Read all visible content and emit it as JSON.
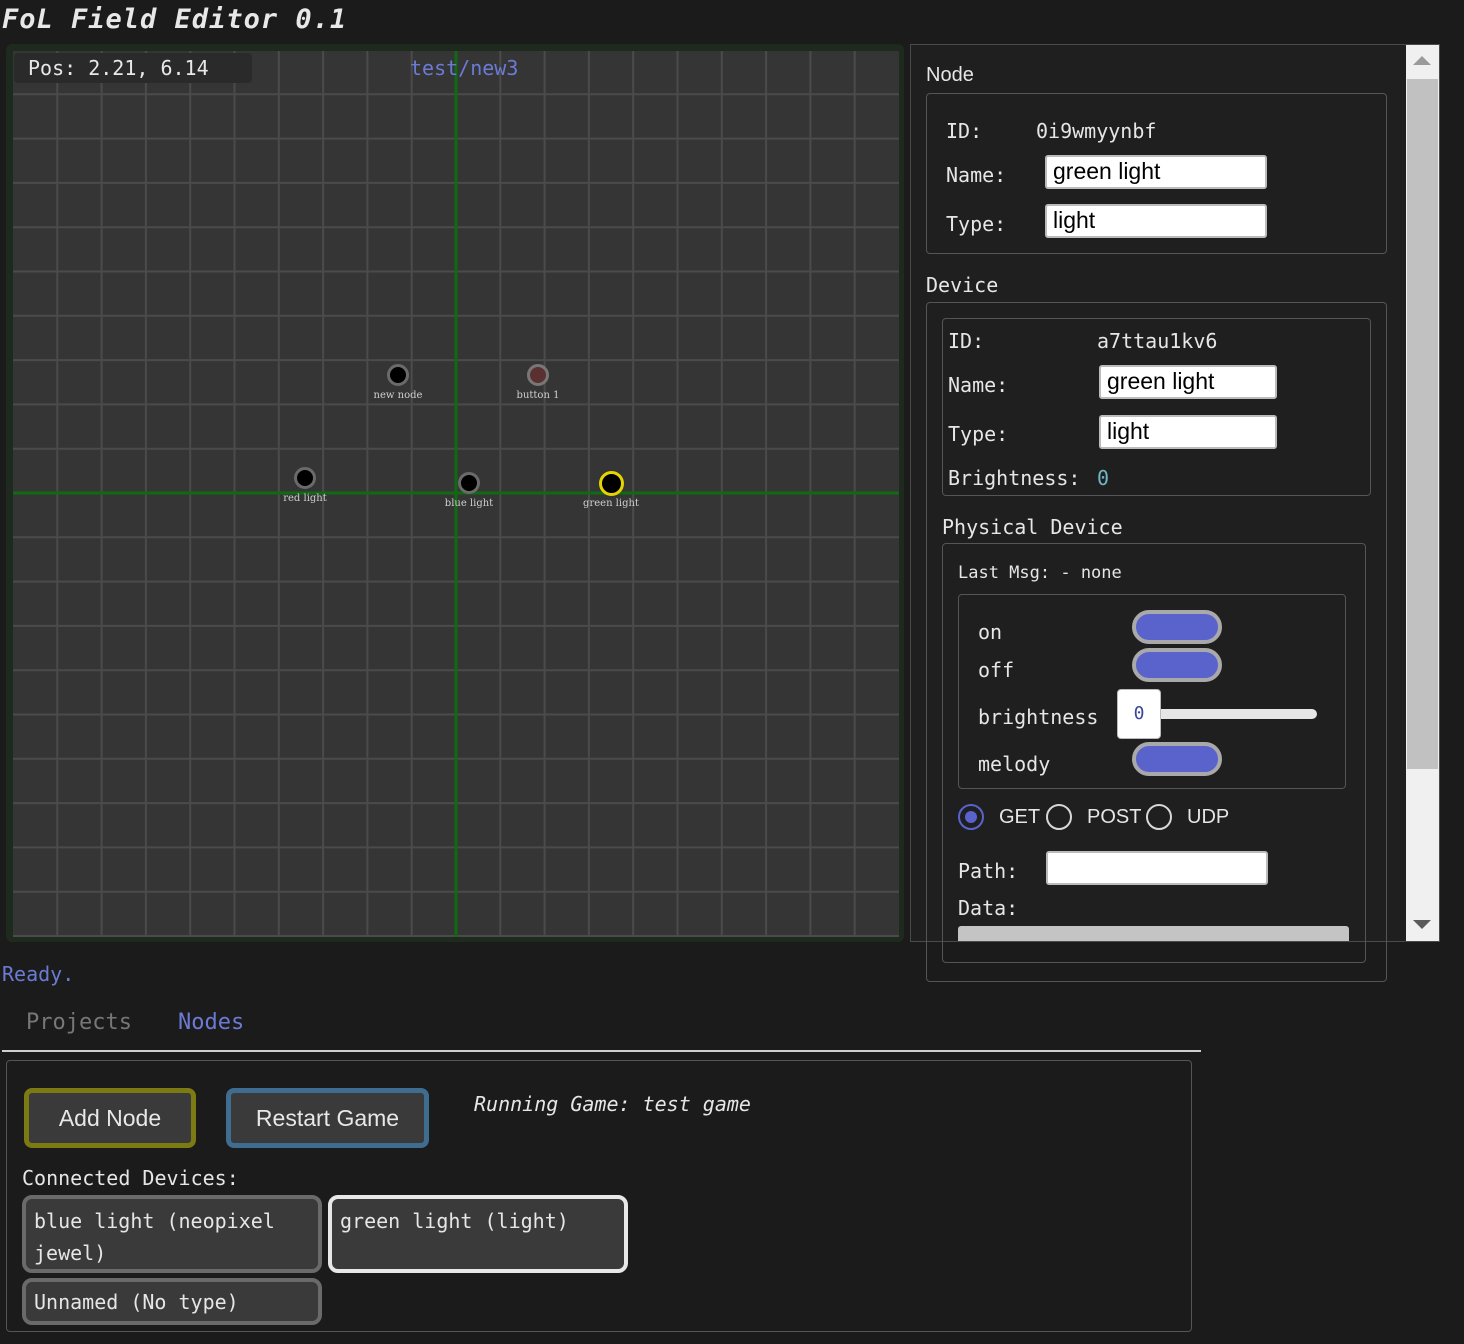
{
  "app": {
    "title": "FoL Field Editor 0.1"
  },
  "canvas": {
    "pos_readout": "Pos: 2.21, 6.14",
    "project_label": "test/new3",
    "nodes": [
      {
        "label": "new node",
        "kind": "normal"
      },
      {
        "label": "button 1",
        "kind": "button"
      },
      {
        "label": "red light",
        "kind": "normal"
      },
      {
        "label": "blue light",
        "kind": "normal"
      },
      {
        "label": "green light",
        "kind": "selected"
      }
    ]
  },
  "node_panel": {
    "section_title": "Node",
    "id_label": "ID:",
    "id_value": "0i9wmyynbf",
    "name_label": "Name:",
    "name_value": "green light",
    "type_label": "Type:",
    "type_value": "light"
  },
  "device_panel": {
    "section_title": "Device",
    "id_label": "ID:",
    "id_value": "a7ttau1kv6",
    "name_label": "Name:",
    "name_value": "green light",
    "type_label": "Type:",
    "type_value": "light",
    "brightness_label": "Brightness:",
    "brightness_value": "0"
  },
  "physical_device": {
    "section_title": "Physical Device",
    "last_msg": "Last Msg: - none",
    "controls": {
      "on_label": "on",
      "off_label": "off",
      "brightness_label": "brightness",
      "brightness_value": "0",
      "melody_label": "melody"
    },
    "methods": {
      "get": "GET",
      "post": "POST",
      "udp": "UDP",
      "selected": "GET"
    },
    "path_label": "Path:",
    "path_value": "",
    "data_label": "Data:"
  },
  "status": "Ready.",
  "tabs": {
    "projects": "Projects",
    "nodes": "Nodes",
    "active": "Nodes"
  },
  "bottom": {
    "add_node": "Add Node",
    "restart_game": "Restart Game",
    "running_game": "Running Game: test game",
    "connected_label": "Connected Devices:",
    "devices": [
      "blue light (neopixel jewel)",
      "green light (light)",
      "Unnamed (No type)"
    ]
  },
  "colors": {
    "accent": "#5a63cc",
    "link": "#6b7bd4",
    "selected_node": "#e6d400",
    "add_border": "#7c7a12",
    "restart_border": "#3f6d8f"
  }
}
